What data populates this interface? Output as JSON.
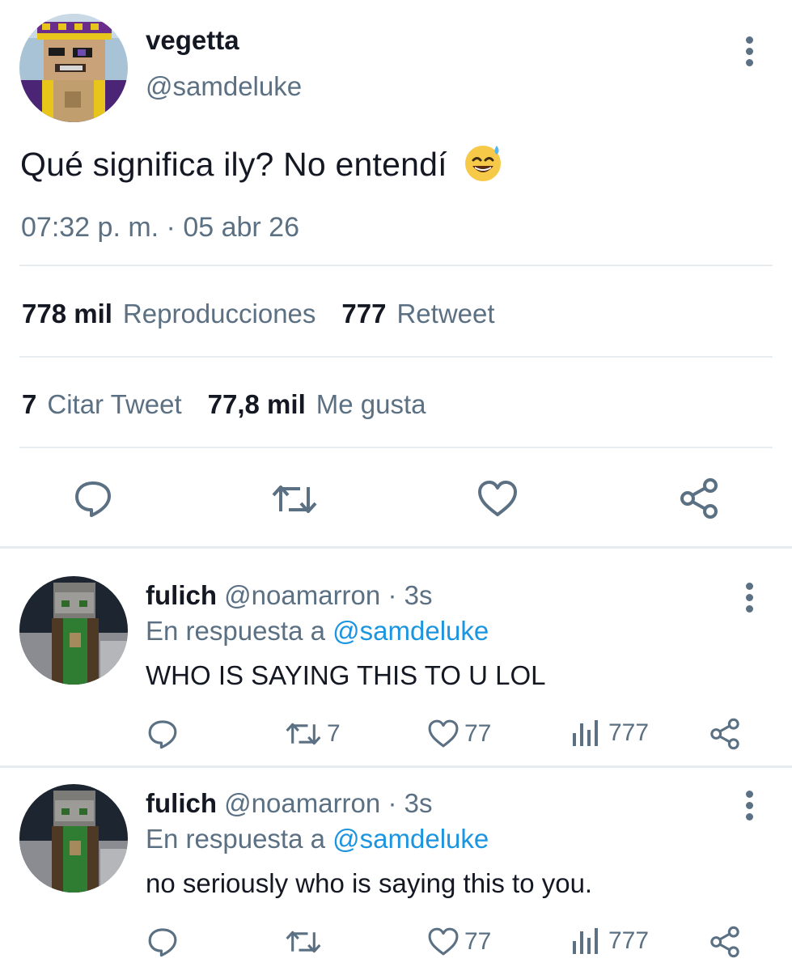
{
  "main_tweet": {
    "display_name": "vegetta",
    "handle": "@samdeluke",
    "text": "Qué significa ily? No entendí",
    "emoji": "😅",
    "timestamp": "07:32 p. m. · 05 abr 26",
    "stats": {
      "views_count": "778 mil",
      "views_label": "Reproducciones",
      "retweets_count": "777",
      "retweets_label": "Retweet",
      "quotes_count": "7",
      "quotes_label": "Citar Tweet",
      "likes_count": "77,8 mil",
      "likes_label": "Me gusta"
    },
    "actions": [
      "reply-icon",
      "retweet-icon",
      "like-icon",
      "share-icon"
    ]
  },
  "replies": [
    {
      "display_name": "fulich",
      "handle": "@noamarron",
      "time": "· 3s",
      "reply_prefix": "En respuesta a",
      "reply_to": "@samdeluke",
      "text": "WHO IS SAYING THIS TO U LOL",
      "retweets": "7",
      "likes": "77",
      "views": "777"
    },
    {
      "display_name": "fulich",
      "handle": "@noamarron",
      "time": "· 3s",
      "reply_prefix": "En respuesta a",
      "reply_to": "@samdeluke",
      "text": "no seriously who is saying this to you.",
      "retweets": "",
      "likes": "77",
      "views": "777"
    }
  ],
  "colors": {
    "text": "#141823",
    "secondary": "#5b7083",
    "link": "#1b95e0",
    "divider": "#e6ecf0"
  }
}
